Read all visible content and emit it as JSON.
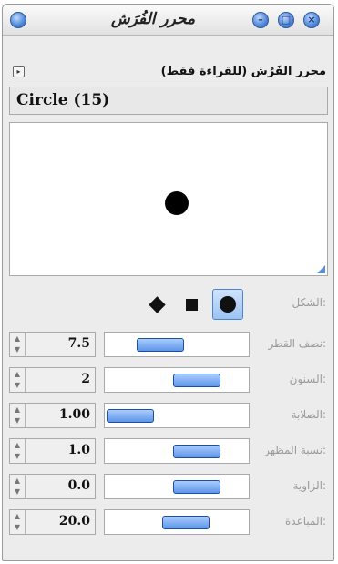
{
  "window": {
    "title": "محرر الفُرَش",
    "buttons": [
      "left",
      "minimize",
      "maximize",
      "close"
    ]
  },
  "header": {
    "label": "محرر الفَرُش (للقراءة فقط)"
  },
  "brush": {
    "name": "Circle (15)"
  },
  "shape": {
    "label": "الشكل:",
    "options": [
      "diamond",
      "square",
      "circle"
    ],
    "selected": "circle"
  },
  "params": [
    {
      "label": "نصف القطر:",
      "value": "7.5",
      "slider_level": 0.32
    },
    {
      "label": "السنون:",
      "value": "2",
      "slider_level": 0.72
    },
    {
      "label": "الصلابة:",
      "value": "1.00",
      "slider_level": 0.0
    },
    {
      "label": "نسبة المظهر:",
      "value": "1.0",
      "slider_level": 0.72
    },
    {
      "label": "الزاوية:",
      "value": "0.0",
      "slider_level": 0.72
    },
    {
      "label": "المباعدة:",
      "value": "20.0",
      "slider_level": 0.6
    }
  ],
  "colors": {
    "accent": "#4f86d9",
    "window_bg": "#ececec"
  }
}
